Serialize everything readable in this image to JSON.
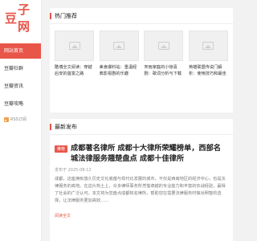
{
  "site": {
    "logo_prefix": "豆",
    "logo_rest": "子网"
  },
  "sidebar": {
    "items": [
      {
        "label": "网站首页",
        "active": true
      },
      {
        "label": "豆瓣社群",
        "active": false
      },
      {
        "label": "豆瓣资讯",
        "active": false
      },
      {
        "label": "豆瓣攻略",
        "active": false
      }
    ],
    "rss_label": "RSS订阅"
  },
  "hot": {
    "title": "热门推荐",
    "items": [
      {
        "title": "酷博全文阅读：穿越后安的首富之路"
      },
      {
        "title": "美食爆料站：重温经典影视剧的乐趣"
      },
      {
        "title": "宋雨家庭的小惊喜剧：歌词分析与下载指南"
      },
      {
        "title": "英雄联盟传说门解析：使用技巧和最佳英雄推荐"
      }
    ]
  },
  "latest": {
    "title": "最新发布",
    "article": {
      "badge": "推荐",
      "title": "成都著名律所 成都十大律所荣耀榜单，西部名城法律服务翘楚盘点 成都十佳律所",
      "meta": "发布于 2025-08-12",
      "body": "成都，这座拥有悠久历史文化底蕴与现代化发展的城市，不仅是西南地区的经济中心，也是法律服务的高地。在这片热土上，众多律师事务所凭借卓越的专业能力和丰富的实战经验，赢得了社会的广泛认可。本文将为您盘点成都知名律所，帮助您在需要法律服务时做出明智的选择，让法律服务更加高效……",
      "read_more": "阅读全文"
    }
  },
  "colors": {
    "accent": "#e8564a",
    "background": "#f2f2f2"
  }
}
